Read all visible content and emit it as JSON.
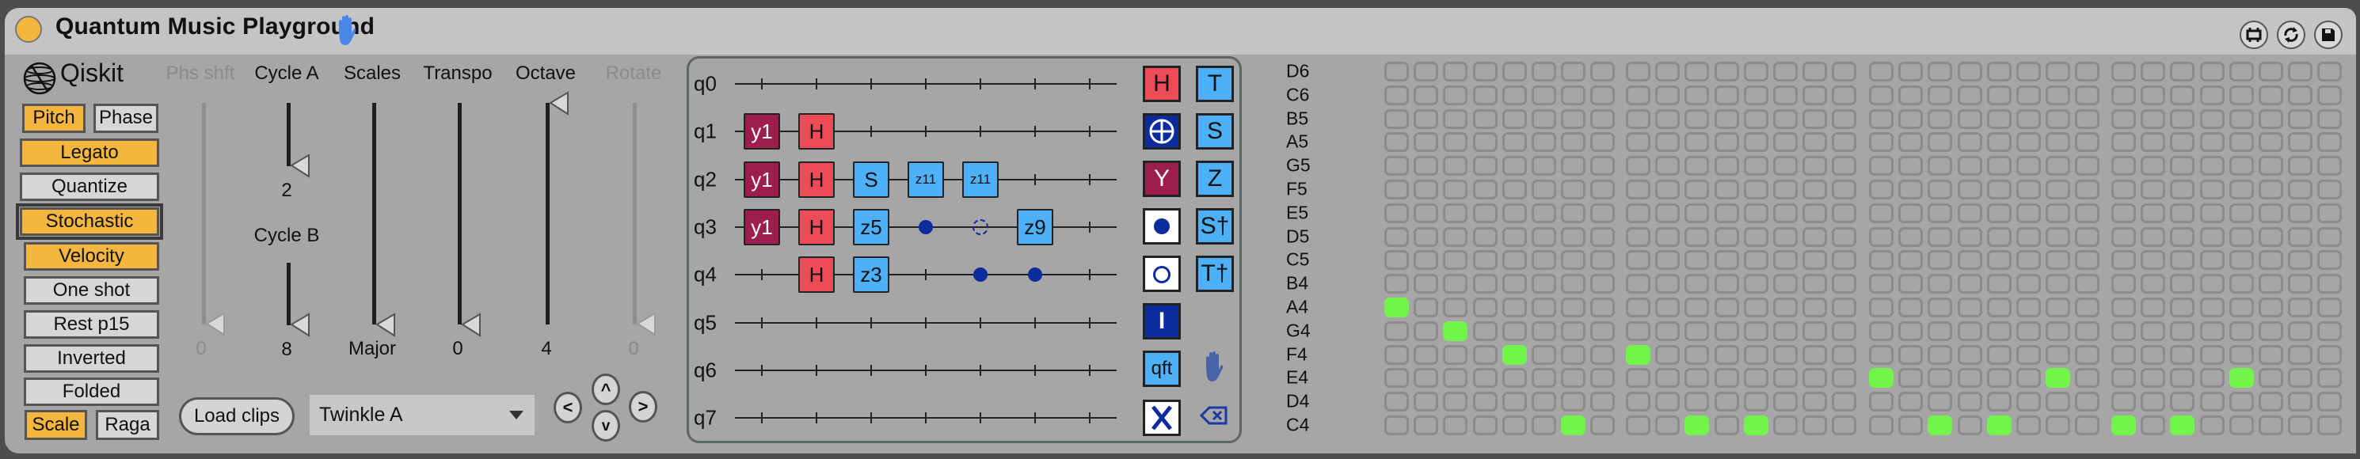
{
  "window": {
    "title": "Quantum Music Playground",
    "title_icons": [
      "hand-icon"
    ],
    "toolbar_icons": [
      "fit-window-icon",
      "refresh-icon",
      "save-icon"
    ]
  },
  "brand": {
    "label": "Qiskit",
    "icon": "qiskit-logo-icon"
  },
  "toggles": {
    "pitch": {
      "label": "Pitch",
      "on": true
    },
    "phase": {
      "label": "Phase",
      "on": false
    },
    "legato": {
      "label": "Legato",
      "on": true
    },
    "quantize": {
      "label": "Quantize",
      "on": false
    },
    "stochastic": {
      "label": "Stochastic",
      "on": true
    },
    "velocity": {
      "label": "Velocity",
      "on": true
    },
    "one_shot": {
      "label": "One shot",
      "on": false
    },
    "rest_p15": {
      "label": "Rest p15",
      "on": false
    },
    "inverted": {
      "label": "Inverted",
      "on": false
    },
    "folded": {
      "label": "Folded",
      "on": false
    },
    "scale": {
      "label": "Scale",
      "on": true
    },
    "raga": {
      "label": "Raga",
      "on": false
    }
  },
  "sliders": {
    "phs_shft": {
      "label": "Phs shft",
      "value": "0",
      "enabled": false
    },
    "cycle_a": {
      "label": "Cycle A",
      "value": "2",
      "enabled": true
    },
    "cycle_b": {
      "label": "Cycle B",
      "value": "8",
      "enabled": true
    },
    "scales": {
      "label": "Scales",
      "value": "Major",
      "enabled": true
    },
    "transpo": {
      "label": "Transpo",
      "value": "0",
      "enabled": true
    },
    "octave": {
      "label": "Octave",
      "value": "4",
      "enabled": true
    },
    "rotate": {
      "label": "Rotate",
      "value": "0",
      "enabled": false
    }
  },
  "clips": {
    "load_label": "Load clips",
    "selected": "Twinkle A",
    "nav": {
      "left": "<",
      "up": "^",
      "right": ">",
      "down": "v"
    }
  },
  "circuit": {
    "qubits": [
      "q0",
      "q1",
      "q2",
      "q3",
      "q4",
      "q5",
      "q6",
      "q7"
    ],
    "columns": 7,
    "gates": [
      {
        "q": 1,
        "col": 0,
        "type": "y",
        "label": "y1"
      },
      {
        "q": 1,
        "col": 1,
        "type": "h",
        "label": "H"
      },
      {
        "q": 2,
        "col": 0,
        "type": "y",
        "label": "y1"
      },
      {
        "q": 2,
        "col": 1,
        "type": "h",
        "label": "H"
      },
      {
        "q": 2,
        "col": 2,
        "type": "z",
        "label": "S"
      },
      {
        "q": 2,
        "col": 3,
        "type": "z",
        "label": "z11",
        "small": true
      },
      {
        "q": 2,
        "col": 4,
        "type": "z",
        "label": "z11",
        "small": true
      },
      {
        "q": 3,
        "col": 0,
        "type": "y",
        "label": "y1"
      },
      {
        "q": 3,
        "col": 1,
        "type": "h",
        "label": "H"
      },
      {
        "q": 3,
        "col": 2,
        "type": "z",
        "label": "z5"
      },
      {
        "q": 3,
        "col": 3,
        "type": "ctrl"
      },
      {
        "q": 3,
        "col": 4,
        "type": "anti-ctrl"
      },
      {
        "q": 3,
        "col": 5,
        "type": "z",
        "label": "z9"
      },
      {
        "q": 4,
        "col": 1,
        "type": "h",
        "label": "H"
      },
      {
        "q": 4,
        "col": 2,
        "type": "z",
        "label": "z3"
      },
      {
        "q": 4,
        "col": 4,
        "type": "ctrl"
      },
      {
        "q": 4,
        "col": 5,
        "type": "ctrl"
      }
    ]
  },
  "palette": [
    {
      "name": "h-gate",
      "label": "H",
      "style": "h"
    },
    {
      "name": "t-gate",
      "label": "T",
      "style": "z"
    },
    {
      "name": "cnot-gate",
      "label": "⊕",
      "style": "navy"
    },
    {
      "name": "s-gate",
      "label": "S",
      "style": "z"
    },
    {
      "name": "y-gate",
      "label": "Y",
      "style": "y"
    },
    {
      "name": "z-gate",
      "label": "Z",
      "style": "z"
    },
    {
      "name": "control-gate",
      "label": "●",
      "style": "white"
    },
    {
      "name": "sdg-gate",
      "label": "S†",
      "style": "z"
    },
    {
      "name": "anti-control-gate",
      "label": "○",
      "style": "white"
    },
    {
      "name": "tdg-gate",
      "label": "T†",
      "style": "z"
    },
    {
      "name": "identity-gate",
      "label": "I",
      "style": "navy"
    },
    {
      "name": "qft-gate",
      "label": "qft",
      "style": "z"
    },
    {
      "name": "x-gate",
      "label": "X",
      "style": "white"
    }
  ],
  "palette_tools": [
    "hand-icon",
    "delete-icon"
  ],
  "piano_roll": {
    "notes": [
      "D6",
      "C6",
      "B5",
      "A5",
      "G5",
      "F5",
      "E5",
      "D5",
      "C5",
      "B4",
      "A4",
      "G4",
      "F4",
      "E4",
      "D4",
      "C4"
    ],
    "steps": 32,
    "active": [
      {
        "step": 0,
        "note": "A4"
      },
      {
        "step": 2,
        "note": "G4"
      },
      {
        "step": 4,
        "note": "F4"
      },
      {
        "step": 6,
        "note": "C4"
      },
      {
        "step": 8,
        "note": "F4"
      },
      {
        "step": 10,
        "note": "C4"
      },
      {
        "step": 12,
        "note": "C4"
      },
      {
        "step": 16,
        "note": "E4"
      },
      {
        "step": 18,
        "note": "C4"
      },
      {
        "step": 20,
        "note": "C4"
      },
      {
        "step": 22,
        "note": "E4"
      },
      {
        "step": 24,
        "note": "C4"
      },
      {
        "step": 26,
        "note": "C4"
      },
      {
        "step": 28,
        "note": "E4"
      }
    ],
    "active_color": "#72f54a"
  },
  "colors": {
    "accent_orange": "#f4b63f",
    "gate_h": "#ec4b57",
    "gate_y": "#9d1e4e",
    "gate_phase": "#4db0f8",
    "gate_navy": "#0c2c9e"
  }
}
